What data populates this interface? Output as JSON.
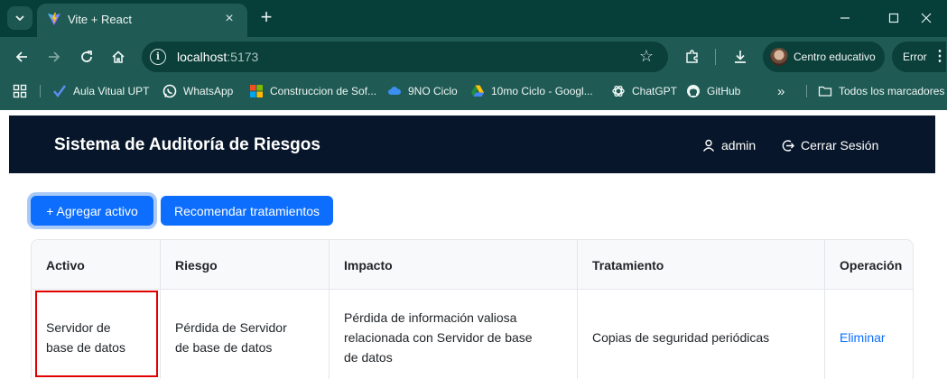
{
  "browser": {
    "tab_title": "Vite + React",
    "url_host": "localhost",
    "url_port": ":5173",
    "profile_name": "Centro educativo",
    "error_label": "Error",
    "bookmarks": [
      {
        "label": "Aula Vitual UPT",
        "icon": "check-icon"
      },
      {
        "label": "WhatsApp",
        "icon": "whatsapp-icon"
      },
      {
        "label": "Construccion de Sof...",
        "icon": "microsoft-icon"
      },
      {
        "label": "9NO Ciclo",
        "icon": "cloud-icon"
      },
      {
        "label": "10mo Ciclo - Googl...",
        "icon": "drive-icon"
      },
      {
        "label": "ChatGPT",
        "icon": "chatgpt-icon"
      },
      {
        "label": "GitHub",
        "icon": "github-icon"
      }
    ],
    "more_bookmarks": "»",
    "all_bookmarks": "Todos los marcadores"
  },
  "app": {
    "title": "Sistema de Auditoría de Riesgos",
    "user": "admin",
    "logout": "Cerrar Sesión",
    "add_button": "+ Agregar activo",
    "recommend_button": "Recomendar tratamientos"
  },
  "table": {
    "headers": {
      "activo": "Activo",
      "riesgo": "Riesgo",
      "impacto": "Impacto",
      "tratamiento": "Tratamiento",
      "operacion": "Operación"
    },
    "rows": [
      {
        "activo_l1": "Servidor de",
        "activo_l2": "base de datos",
        "riesgo_l1": "Pérdida de Servidor",
        "riesgo_l2": "de base de datos",
        "impacto_l1": "Pérdida de información valiosa",
        "impacto_l2": "relacionada con Servidor de base",
        "impacto_l3": "de datos",
        "tratamiento": "Copias de seguridad periódicas",
        "operacion": "Eliminar"
      }
    ]
  },
  "colors": {
    "chrome_dark": "#063f3a",
    "chrome": "#1f5a54",
    "header_bg": "#07162a",
    "primary": "#0d6efd",
    "highlight": "#e00000"
  }
}
